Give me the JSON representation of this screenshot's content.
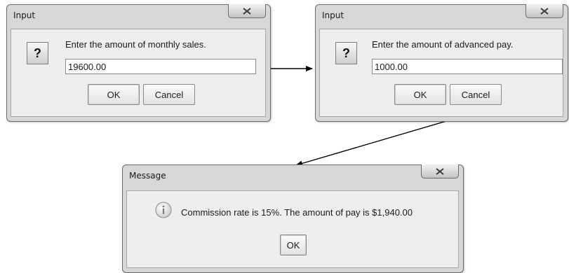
{
  "dialog_sales": {
    "title": "Input",
    "prompt": "Enter the amount of monthly sales.",
    "value": "19600.00",
    "ok_label": "OK",
    "cancel_label": "Cancel",
    "icon": "question-icon",
    "close_icon": "close-icon"
  },
  "dialog_pay": {
    "title": "Input",
    "prompt": "Enter the amount of advanced pay.",
    "value": "1000.00",
    "ok_label": "OK",
    "cancel_label": "Cancel",
    "icon": "question-icon",
    "close_icon": "close-icon"
  },
  "dialog_message": {
    "title": "Message",
    "text": "Commission rate is 15%. The amount of pay is $1,940.00",
    "ok_label": "OK",
    "icon": "info-icon",
    "close_icon": "close-icon"
  },
  "colors": {
    "dialog_frame": "#d7d7d7",
    "content_panel": "#eeeeee",
    "arrow": "#000000"
  }
}
